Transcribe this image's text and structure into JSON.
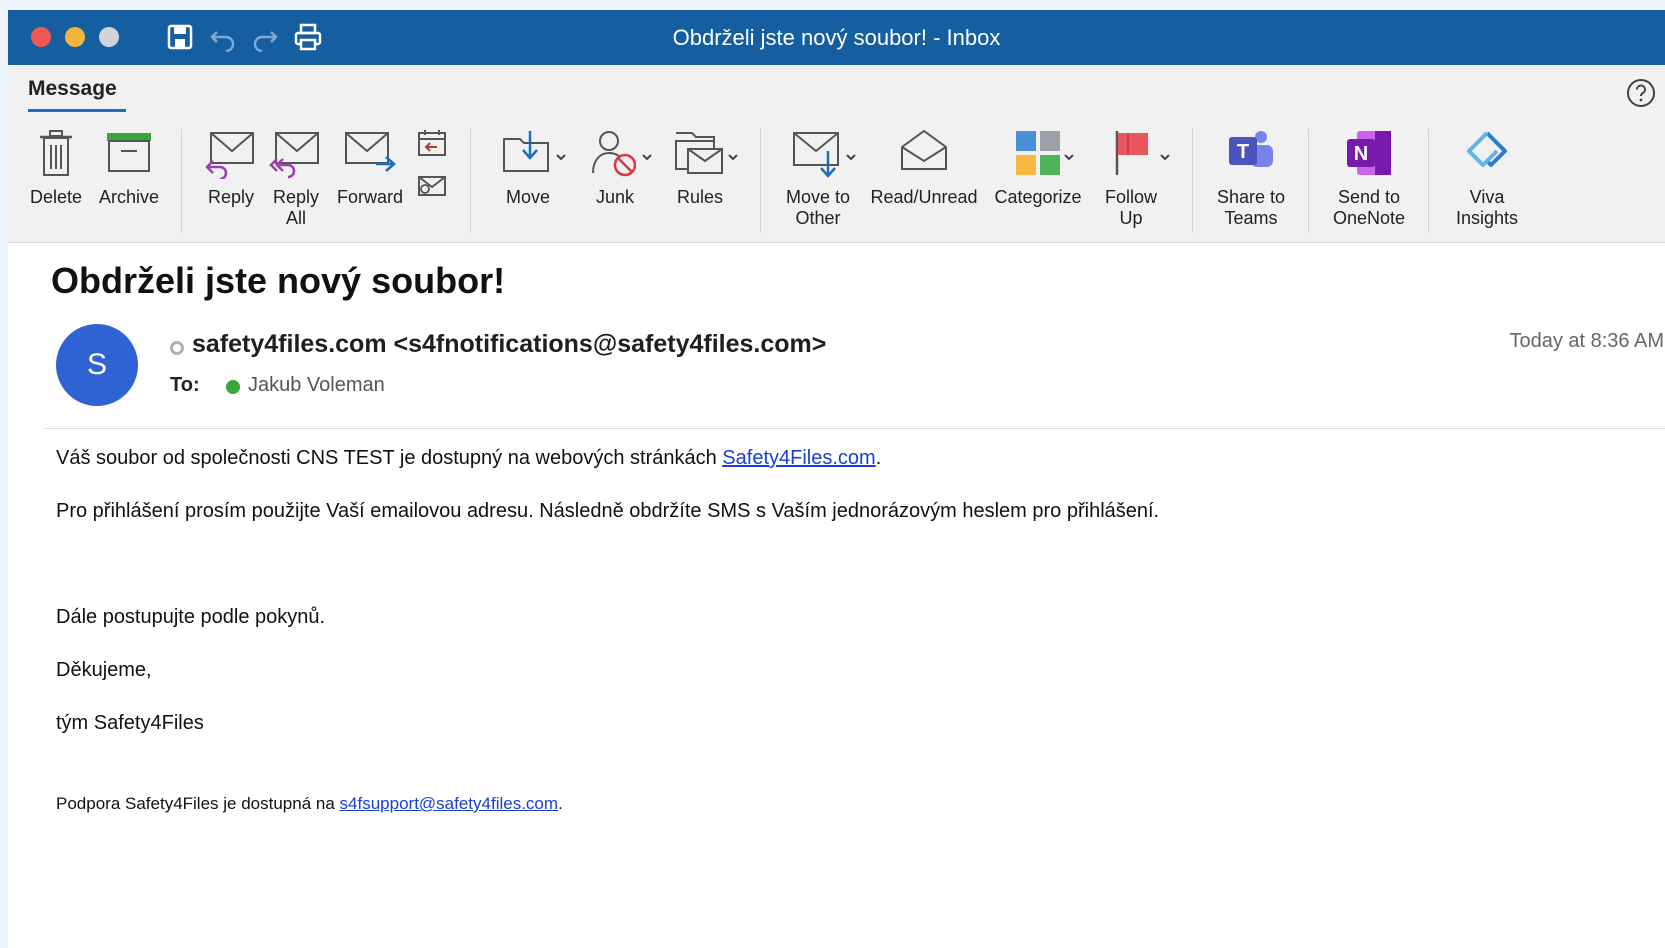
{
  "window": {
    "title": "Obdrželi jste nový soubor! - Inbox"
  },
  "tabs": {
    "active": "Message"
  },
  "ribbon": {
    "delete": "Delete",
    "archive": "Archive",
    "reply": "Reply",
    "reply_all": "Reply\nAll",
    "forward": "Forward",
    "move": "Move",
    "junk": "Junk",
    "rules": "Rules",
    "move_to_other": "Move to\nOther",
    "read_unread": "Read/Unread",
    "categorize": "Categorize",
    "follow_up": "Follow\nUp",
    "share_to_teams": "Share to\nTeams",
    "send_to_onenote": "Send to\nOneNote",
    "viva_insights": "Viva\nInsights"
  },
  "message": {
    "subject": "Obdrželi jste nový soubor!",
    "avatar_initial": "S",
    "sender": "safety4files.com <s4fnotifications@safety4files.com>",
    "to_label": "To:",
    "recipient": "Jakub Voleman",
    "date": "Today at 8:36 AM",
    "body": {
      "p1_text": "Váš soubor od společnosti CNS TEST je dostupný na webových stránkách ",
      "p1_link": "Safety4Files.com",
      "p1_end": ".",
      "p2": "Pro přihlášení prosím použijte Vaší emailovou adresu. Následně obdržíte SMS s Vaším jednorázovým heslem pro přihlášení.",
      "p3": "Dále postupujte podle pokynů.",
      "p4": "Děkujeme,",
      "p5": "tým Safety4Files",
      "footer_text": "Podpora Safety4Files je dostupná na ",
      "footer_link": "s4fsupport@safety4files.com",
      "footer_end": "."
    }
  },
  "colors": {
    "titlebar": "#155ea0",
    "accent": "#1a6fc2",
    "avatar": "#2f62d2",
    "link": "#1a3fd6"
  }
}
